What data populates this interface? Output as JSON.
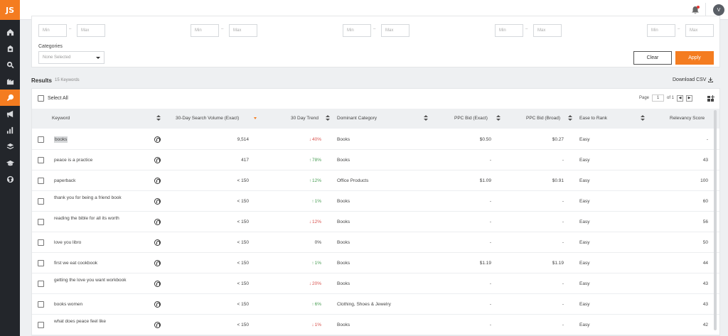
{
  "app": {
    "logo": "JS"
  },
  "topbar": {
    "avatar": "V"
  },
  "filters": {
    "ranges": [
      {
        "min": "Min",
        "max": "Max"
      },
      {
        "min": "Min",
        "max": "Max"
      },
      {
        "min": "Min",
        "max": "Max"
      },
      {
        "min": "Min",
        "max": "Max"
      },
      {
        "min": "Min",
        "max": "Max"
      }
    ],
    "categories_label": "Categories",
    "categories_value": "None Selected",
    "clear_label": "Clear",
    "apply_label": "Apply"
  },
  "results": {
    "title": "Results",
    "count": "15 Keywords",
    "download_label": "Download CSV"
  },
  "table": {
    "select_all": "Select All",
    "pager": {
      "page_label": "Page",
      "page": "1",
      "of_label": "of 1"
    },
    "headers": {
      "keyword": "Keyword",
      "volume": "30-Day Search Volume (Exact)",
      "trend": "30 Day Trend",
      "category": "Dominant Category",
      "ppc_exact": "PPC Bid (Exact)",
      "ppc_broad": "PPC Bid (Broad)",
      "ease": "Ease to Rank",
      "relevancy": "Relevancy Score"
    },
    "rows": [
      {
        "keyword": "books",
        "volume": "9,514",
        "trend": "40%",
        "trend_dir": "down",
        "category": "Books",
        "ppc_exact": "$0.50",
        "ppc_broad": "$0.27",
        "ease": "Easy",
        "relevancy": "-"
      },
      {
        "keyword": "peace is a practice",
        "volume": "417",
        "trend": "78%",
        "trend_dir": "up",
        "category": "Books",
        "ppc_exact": "-",
        "ppc_broad": "-",
        "ease": "Easy",
        "relevancy": "43"
      },
      {
        "keyword": "paperback",
        "volume": "< 150",
        "trend": "12%",
        "trend_dir": "up",
        "category": "Office Products",
        "ppc_exact": "$1.09",
        "ppc_broad": "$0.91",
        "ease": "Easy",
        "relevancy": "100"
      },
      {
        "keyword": "thank you for being a friend book",
        "volume": "< 150",
        "trend": "1%",
        "trend_dir": "up",
        "category": "Books",
        "ppc_exact": "-",
        "ppc_broad": "-",
        "ease": "Easy",
        "relevancy": "60"
      },
      {
        "keyword": "reading the bible for all its worth",
        "volume": "< 150",
        "trend": "12%",
        "trend_dir": "down",
        "category": "Books",
        "ppc_exact": "-",
        "ppc_broad": "-",
        "ease": "Easy",
        "relevancy": "56"
      },
      {
        "keyword": "love you libro",
        "volume": "< 150",
        "trend": "0%",
        "trend_dir": "none",
        "category": "Books",
        "ppc_exact": "-",
        "ppc_broad": "-",
        "ease": "Easy",
        "relevancy": "50"
      },
      {
        "keyword": "first we eat cookbook",
        "volume": "< 150",
        "trend": "1%",
        "trend_dir": "up",
        "category": "Books",
        "ppc_exact": "$1.19",
        "ppc_broad": "$1.19",
        "ease": "Easy",
        "relevancy": "44"
      },
      {
        "keyword": "getting the love you want workbook",
        "volume": "< 150",
        "trend": "20%",
        "trend_dir": "down",
        "category": "Books",
        "ppc_exact": "-",
        "ppc_broad": "-",
        "ease": "Easy",
        "relevancy": "43"
      },
      {
        "keyword": "books women",
        "volume": "< 150",
        "trend": "6%",
        "trend_dir": "up",
        "category": "Clothing, Shoes & Jewelry",
        "ppc_exact": "-",
        "ppc_broad": "-",
        "ease": "Easy",
        "relevancy": "43"
      },
      {
        "keyword": "what does peace feel like",
        "volume": "< 150",
        "trend": "1%",
        "trend_dir": "down",
        "category": "Books",
        "ppc_exact": "-",
        "ppc_broad": "-",
        "ease": "Easy",
        "relevancy": "42"
      }
    ]
  },
  "colors": {
    "accent": "#f47c20",
    "rail": "#23262b",
    "up": "#4a9e55",
    "down": "#d9534f"
  }
}
